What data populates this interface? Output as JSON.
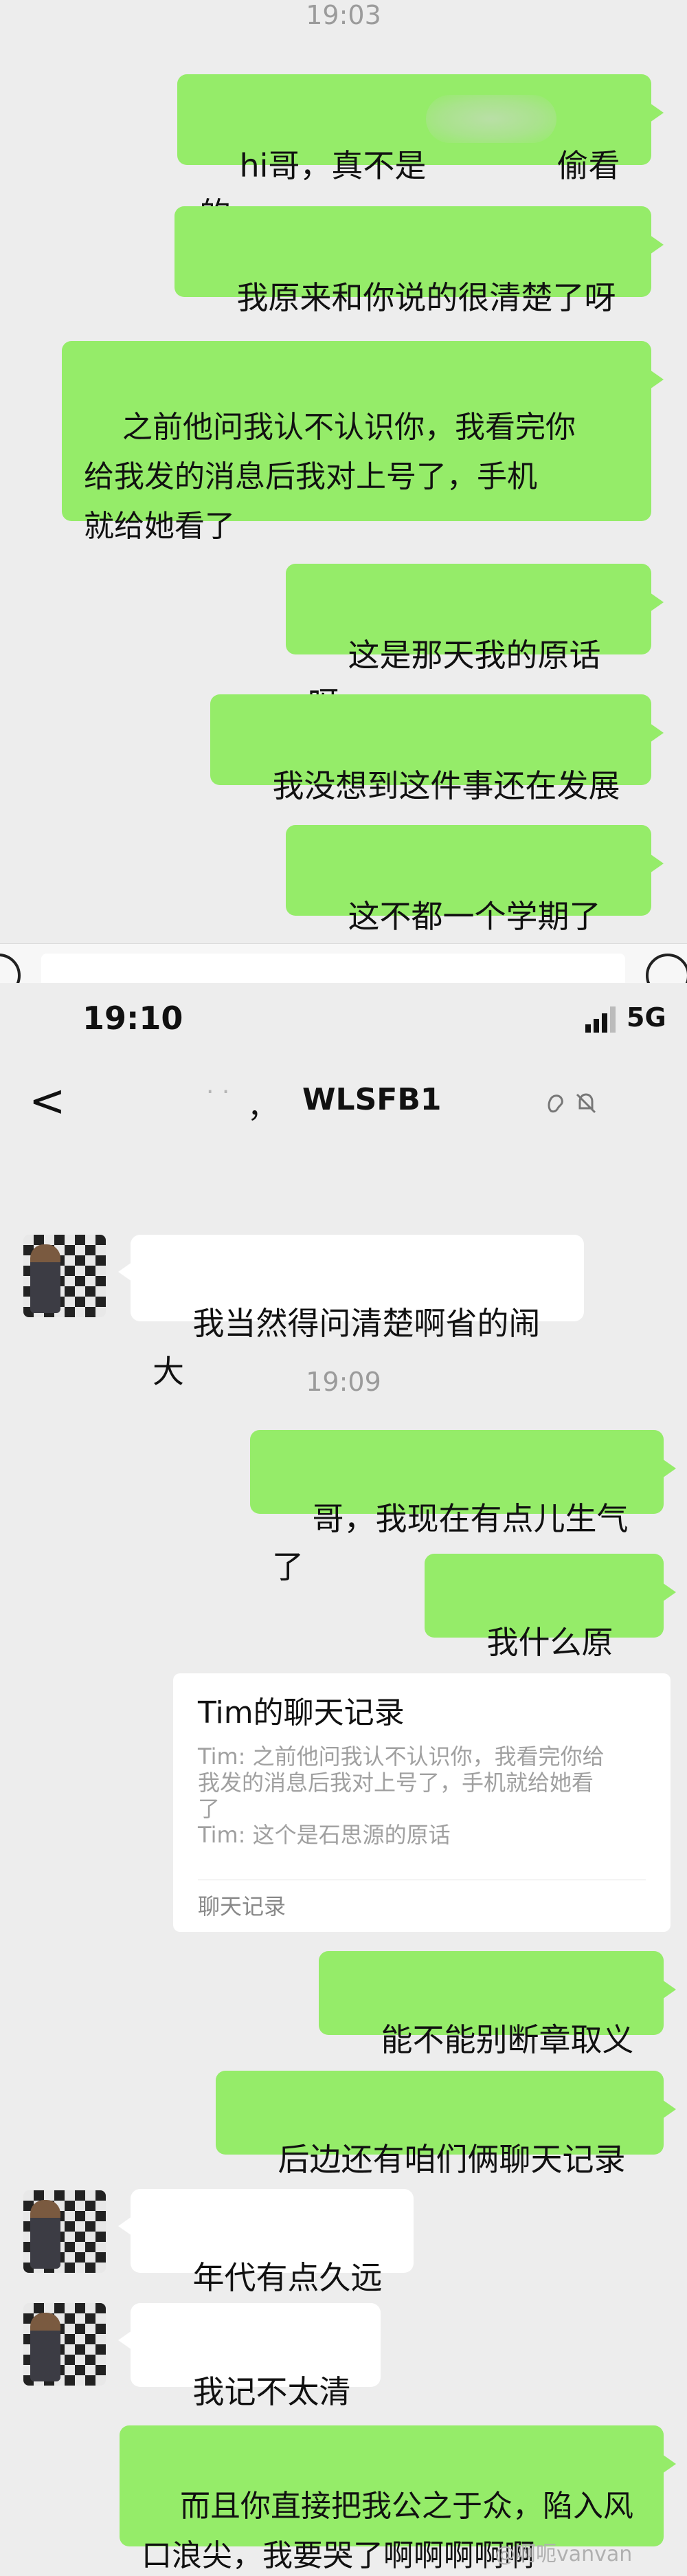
{
  "screen1": {
    "timestamp": "19:03",
    "messages": [
      {
        "text": "hi哥，真不是",
        "text2": "偷看的"
      },
      {
        "text": "我原来和你说的很清楚了呀"
      },
      {
        "text": "之前他问我认不认识你，我看完你\n给我发的消息后我对上号了，手机\n就给她看了"
      },
      {
        "text": "这是那天我的原话呀"
      },
      {
        "text": "我没想到这件事还在发展"
      },
      {
        "text": "这不都一个学期了吗"
      }
    ]
  },
  "screen2": {
    "status_bar": {
      "time": "19:10",
      "network": "5G"
    },
    "header": {
      "title": "WLSFB1",
      "comma": "，",
      "back_label": "<"
    },
    "timestamp": "19:09",
    "messages": [
      {
        "text": "我当然得问清楚啊省的闹大"
      },
      {
        "text": "哥，我现在有点儿生气了"
      },
      {
        "text": "我什么原话呀"
      },
      {
        "text": "能不能别断章取义呀"
      },
      {
        "text": "后边还有咱们俩聊天记录呢"
      },
      {
        "text": "年代有点久远了"
      },
      {
        "text": "我记不太清了"
      },
      {
        "text": "而且你直接把我公之于众，陷入风\n口浪尖，我要哭了啊啊啊啊啊"
      }
    ],
    "chat_record_card": {
      "title": "Tim的聊天记录",
      "body": "Tim: 之前他问我认不认识你，我看完你给\n我发的消息后我对上号了，手机就给她看\n了\nTim: 这个是石思源的原话",
      "footer": "聊天记录"
    }
  },
  "watermark": "@啊呃vanvan",
  "colors": {
    "background": "#ededed",
    "outgoing_bubble": "#95ec69",
    "incoming_bubble": "#ffffff"
  },
  "icons": [
    "emoji-icon",
    "voice-icon",
    "back-icon",
    "signal-icon",
    "ear-icon",
    "mute-icon"
  ]
}
